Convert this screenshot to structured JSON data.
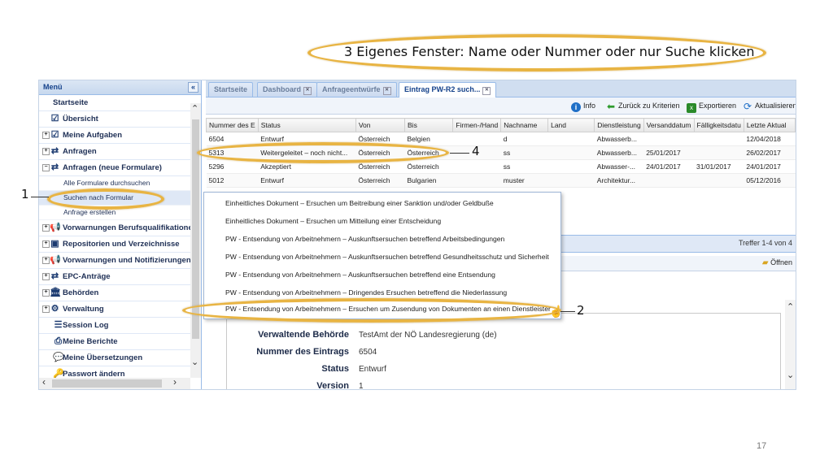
{
  "annotations": {
    "heading": "3 Eigenes Fenster: Name oder Nummer oder nur Suche klicken",
    "marker_1": "1",
    "marker_2": "2",
    "marker_4": "4"
  },
  "page_number": "17",
  "menu": {
    "title": "Menü",
    "collapse_icon": "«",
    "items": [
      {
        "label": "Startseite"
      },
      {
        "label": "Übersicht"
      },
      {
        "label": "Meine Aufgaben"
      },
      {
        "label": "Anfragen"
      },
      {
        "label": "Anfragen (neue Formulare)"
      },
      {
        "label": "Alle Formulare durchsuchen"
      },
      {
        "label": "Suchen nach Formular"
      },
      {
        "label": "Anfrage erstellen"
      },
      {
        "label": "Vorwarnungen Berufsqualifikationen"
      },
      {
        "label": "Repositorien und Verzeichnisse"
      },
      {
        "label": "Vorwarnungen und Notifizierungen"
      },
      {
        "label": "EPC-Anträge"
      },
      {
        "label": "Behörden"
      },
      {
        "label": "Verwaltung"
      },
      {
        "label": "Session Log"
      },
      {
        "label": "Meine Berichte"
      },
      {
        "label": "Meine Übersetzungen"
      },
      {
        "label": "Passwort ändern"
      }
    ]
  },
  "tabs": [
    {
      "label": "Startseite"
    },
    {
      "label": "Dashboard"
    },
    {
      "label": "Anfrageentwürfe"
    },
    {
      "label": "Eintrag PW-R2 such..."
    }
  ],
  "toolbar": {
    "info": "Info",
    "back": "Zurück zu Kriterien",
    "export": "Exportieren",
    "refresh": "Aktualisieren"
  },
  "grid": {
    "columns": [
      "Nummer des E",
      "Status",
      "Von",
      "Bis",
      "Firmen-/Hand",
      "Nachname",
      "Land",
      "Dienstleistung",
      "Versanddatum",
      "Fälligkeitsdatu",
      "Letzte Aktual"
    ],
    "rows": [
      [
        "6504",
        "Entwurf",
        "Österreich",
        "Belgien",
        "",
        "d",
        "",
        "Abwasserb...",
        "",
        "",
        "12/04/2018"
      ],
      [
        "5313",
        "Weitergeleitet – noch nicht...",
        "Österreich",
        "Österreich",
        "",
        "ss",
        "",
        "Abwasserb...",
        "25/01/2017",
        "",
        "26/02/2017"
      ],
      [
        "5296",
        "Akzeptiert",
        "Österreich",
        "Österreich",
        "",
        "ss",
        "",
        "Abwasser-...",
        "24/01/2017",
        "31/01/2017",
        "24/01/2017"
      ],
      [
        "5012",
        "Entwurf",
        "Österreich",
        "Bulgarien",
        "",
        "muster",
        "",
        "Architektur...",
        "",
        "",
        "05/12/2016"
      ]
    ]
  },
  "lower": {
    "hits": "Treffer 1-4 von 4",
    "open": "Öffnen"
  },
  "detail": {
    "authority_label": "Verwaltende Behörde",
    "authority_value": "TestAmt der NÖ Landesregierung (de)",
    "entry_label": "Nummer des Eintrags",
    "entry_value": "6504",
    "status_label": "Status",
    "status_value": "Entwurf",
    "version_label": "Version",
    "version_value": "1"
  },
  "dropdown": [
    "Einheitliches Dokument – Ersuchen um Beitreibung einer Sanktion und/oder Geldbuße",
    "Einheitliches Dokument – Ersuchen um Mitteilung einer Entscheidung",
    "PW - Entsendung von Arbeitnehmern – Auskunftsersuchen betreffend Arbeitsbedingungen",
    "PW - Entsendung von Arbeitnehmern – Auskunftsersuchen betreffend Gesundheitsschutz und Sicherheit",
    "PW - Entsendung von Arbeitnehmern – Auskunftsersuchen betreffend eine Entsendung",
    "PW - Entsendung von Arbeitnehmern – Dringendes Ersuchen betreffend die Niederlassung",
    "PW - Entsendung von Arbeitnehmern – Ersuchen um Zusendung von Dokumenten an einen Dienstleister"
  ],
  "colors": {
    "highlight_ring": "#e8b443",
    "menu_text": "#1e2f55",
    "header_blue": "#15428b"
  }
}
